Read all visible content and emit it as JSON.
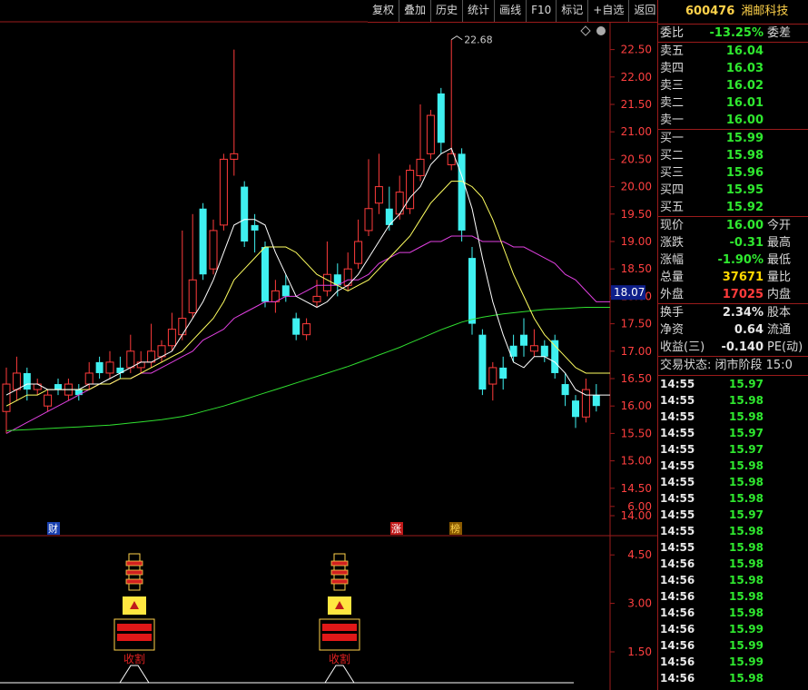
{
  "toolbar": [
    "复权",
    "叠加",
    "历史",
    "统计",
    "画线",
    "F10",
    "标记",
    "+自选",
    "返回"
  ],
  "stock": {
    "code": "600476",
    "name": "湘邮科技"
  },
  "quote": {
    "ratio": {
      "label": "委比",
      "value": "-13.25%",
      "suffix": "委差"
    },
    "asks": [
      {
        "label": "卖五",
        "price": "16.04"
      },
      {
        "label": "卖四",
        "price": "16.03"
      },
      {
        "label": "卖三",
        "price": "16.02"
      },
      {
        "label": "卖二",
        "price": "16.01"
      },
      {
        "label": "卖一",
        "price": "16.00"
      }
    ],
    "bids": [
      {
        "label": "买一",
        "price": "15.99"
      },
      {
        "label": "买二",
        "price": "15.98"
      },
      {
        "label": "买三",
        "price": "15.96"
      },
      {
        "label": "买四",
        "price": "15.95"
      },
      {
        "label": "买五",
        "price": "15.92"
      }
    ],
    "stats1": [
      {
        "label": "现价",
        "value": "16.00",
        "suffix": "今开",
        "color": "down"
      },
      {
        "label": "涨跌",
        "value": "-0.31",
        "suffix": "最高",
        "color": "down"
      },
      {
        "label": "涨幅",
        "value": "-1.90%",
        "suffix": "最低",
        "color": "down"
      },
      {
        "label": "总量",
        "value": "37671",
        "suffix": "量比",
        "color": "yel"
      },
      {
        "label": "外盘",
        "value": "17025",
        "suffix": "内盘",
        "color": "up"
      }
    ],
    "stats2": [
      {
        "label": "换手",
        "value": "2.34%",
        "suffix": "股本",
        "color": "wht"
      },
      {
        "label": "净资",
        "value": "0.64",
        "suffix": "流通",
        "color": "wht"
      },
      {
        "label": "收益(三)",
        "value": "-0.140",
        "suffix": "PE(动)",
        "color": "wht"
      }
    ],
    "status": "交易状态: 闭市阶段 15:0",
    "ticks": [
      [
        "14:55",
        "15.97"
      ],
      [
        "14:55",
        "15.98"
      ],
      [
        "14:55",
        "15.98"
      ],
      [
        "14:55",
        "15.97"
      ],
      [
        "14:55",
        "15.97"
      ],
      [
        "14:55",
        "15.98"
      ],
      [
        "14:55",
        "15.98"
      ],
      [
        "14:55",
        "15.98"
      ],
      [
        "14:55",
        "15.97"
      ],
      [
        "14:55",
        "15.98"
      ],
      [
        "14:55",
        "15.98"
      ],
      [
        "14:56",
        "15.98"
      ],
      [
        "14:56",
        "15.98"
      ],
      [
        "14:56",
        "15.98"
      ],
      [
        "14:56",
        "15.98"
      ],
      [
        "14:56",
        "15.99"
      ],
      [
        "14:56",
        "15.99"
      ],
      [
        "14:56",
        "15.99"
      ],
      [
        "14:56",
        "15.98"
      ]
    ]
  },
  "markers": {
    "cai": "财",
    "zhang": "涨",
    "bang": "榜",
    "harvest": "收割"
  },
  "current_price_tag": "18.07",
  "peak_label": "22.68",
  "colors": {
    "up": "#ff3b3b",
    "down": "#3ff0f0",
    "ma5": "#ffffff",
    "ma10": "#ffff60",
    "ma20": "#e040e0",
    "ma60": "#30e030",
    "grid": "#9b1b1b",
    "axis_text": "#ff4040"
  },
  "chart_data": [
    {
      "type": "candlestick",
      "ylim": [
        13.75,
        22.75
      ],
      "y_ticks": [
        "22.50",
        "22.00",
        "21.50",
        "21.00",
        "20.50",
        "20.00",
        "19.50",
        "19.00",
        "18.50",
        "18.00",
        "17.50",
        "17.00",
        "16.50",
        "16.00",
        "15.50",
        "15.00",
        "14.50",
        "14.00"
      ],
      "candles": [
        [
          15.9,
          16.4,
          16.7,
          15.5
        ],
        [
          16.3,
          16.6,
          16.9,
          16.1
        ],
        [
          16.6,
          16.3,
          16.7,
          16.1
        ],
        [
          16.3,
          16.4,
          16.5,
          16.2
        ],
        [
          16.0,
          16.2,
          16.3,
          15.9
        ],
        [
          16.4,
          16.3,
          16.5,
          16.2
        ],
        [
          16.2,
          16.4,
          16.5,
          16.1
        ],
        [
          16.3,
          16.2,
          16.4,
          16.1
        ],
        [
          16.4,
          16.6,
          16.8,
          16.3
        ],
        [
          16.8,
          16.6,
          16.9,
          16.5
        ],
        [
          16.6,
          16.8,
          17.0,
          16.5
        ],
        [
          16.7,
          16.6,
          16.9,
          16.5
        ],
        [
          16.7,
          17.0,
          17.3,
          16.6
        ],
        [
          16.7,
          16.8,
          17.0,
          16.6
        ],
        [
          16.8,
          17.0,
          17.5,
          16.7
        ],
        [
          16.9,
          17.1,
          17.2,
          16.8
        ],
        [
          17.1,
          17.4,
          17.7,
          17.0
        ],
        [
          17.3,
          17.6,
          19.2,
          17.2
        ],
        [
          17.7,
          18.3,
          19.5,
          17.6
        ],
        [
          19.6,
          18.4,
          19.7,
          18.3
        ],
        [
          18.5,
          19.2,
          19.4,
          18.4
        ],
        [
          19.3,
          20.5,
          20.6,
          19.2
        ],
        [
          20.5,
          20.6,
          22.5,
          20.2
        ],
        [
          20.0,
          19.0,
          20.1,
          18.9
        ],
        [
          19.3,
          19.2,
          19.5,
          18.8
        ],
        [
          18.9,
          17.9,
          19.0,
          17.8
        ],
        [
          17.9,
          18.1,
          18.3,
          17.7
        ],
        [
          18.2,
          18.0,
          18.4,
          17.9
        ],
        [
          17.6,
          17.3,
          17.7,
          17.2
        ],
        [
          17.3,
          17.5,
          17.6,
          17.2
        ],
        [
          17.9,
          18.0,
          18.3,
          17.8
        ],
        [
          18.1,
          18.4,
          19.0,
          18.0
        ],
        [
          18.4,
          18.2,
          18.6,
          18.0
        ],
        [
          18.2,
          18.5,
          18.8,
          18.1
        ],
        [
          18.6,
          19.0,
          19.4,
          18.5
        ],
        [
          19.2,
          19.6,
          20.5,
          19.1
        ],
        [
          19.7,
          20.0,
          20.6,
          19.5
        ],
        [
          19.6,
          19.3,
          20.0,
          19.2
        ],
        [
          19.5,
          19.9,
          20.2,
          19.4
        ],
        [
          19.6,
          20.3,
          20.4,
          19.5
        ],
        [
          20.2,
          20.5,
          21.5,
          20.1
        ],
        [
          20.6,
          21.3,
          21.4,
          20.5
        ],
        [
          21.7,
          20.8,
          21.8,
          20.6
        ],
        [
          20.4,
          20.6,
          22.68,
          20.3
        ],
        [
          20.6,
          19.2,
          20.7,
          19.0
        ],
        [
          18.7,
          17.5,
          18.9,
          17.3
        ],
        [
          17.3,
          16.3,
          17.4,
          16.2
        ],
        [
          16.4,
          16.7,
          16.8,
          16.1
        ],
        [
          16.7,
          16.5,
          16.9,
          16.3
        ],
        [
          17.1,
          16.9,
          17.3,
          16.8
        ],
        [
          17.3,
          17.1,
          17.6,
          16.9
        ],
        [
          17.0,
          17.1,
          17.4,
          16.9
        ],
        [
          17.1,
          16.9,
          17.2,
          16.8
        ],
        [
          17.2,
          16.6,
          17.3,
          16.5
        ],
        [
          16.4,
          16.2,
          16.6,
          16.0
        ],
        [
          16.1,
          15.8,
          16.2,
          15.6
        ],
        [
          15.8,
          16.3,
          16.5,
          15.7
        ],
        [
          16.2,
          16.0,
          16.4,
          15.9
        ]
      ],
      "ma_values": {
        "ma5": [
          16.2,
          16.3,
          16.4,
          16.4,
          16.3,
          16.3,
          16.3,
          16.3,
          16.4,
          16.4,
          16.5,
          16.6,
          16.7,
          16.8,
          16.8,
          16.9,
          17.0,
          17.3,
          17.6,
          17.9,
          18.3,
          18.8,
          19.3,
          19.4,
          19.4,
          19.3,
          18.8,
          18.4,
          18.0,
          17.9,
          17.8,
          17.9,
          18.1,
          18.2,
          18.4,
          18.7,
          19.0,
          19.3,
          19.5,
          19.8,
          20.0,
          20.4,
          20.6,
          20.7,
          20.2,
          19.6,
          18.7,
          17.9,
          17.3,
          16.8,
          16.7,
          16.9,
          16.9,
          16.8,
          16.6,
          16.3,
          16.2,
          16.2
        ],
        "ma10": [
          16.0,
          16.1,
          16.2,
          16.2,
          16.3,
          16.3,
          16.3,
          16.3,
          16.3,
          16.4,
          16.4,
          16.5,
          16.5,
          16.6,
          16.7,
          16.8,
          16.9,
          17.0,
          17.2,
          17.4,
          17.6,
          17.9,
          18.3,
          18.5,
          18.7,
          18.9,
          18.9,
          18.9,
          18.8,
          18.6,
          18.4,
          18.3,
          18.2,
          18.1,
          18.2,
          18.3,
          18.5,
          18.7,
          18.9,
          19.1,
          19.4,
          19.7,
          19.9,
          20.1,
          20.1,
          20.0,
          19.8,
          19.4,
          18.9,
          18.4,
          18.0,
          17.6,
          17.3,
          17.1,
          16.9,
          16.7,
          16.6,
          16.6
        ],
        "ma20": [
          15.5,
          15.6,
          15.7,
          15.8,
          15.9,
          16.0,
          16.1,
          16.2,
          16.3,
          16.4,
          16.4,
          16.5,
          16.5,
          16.6,
          16.6,
          16.7,
          16.8,
          16.9,
          17.0,
          17.2,
          17.3,
          17.4,
          17.6,
          17.7,
          17.8,
          17.9,
          17.9,
          18.0,
          18.0,
          18.1,
          18.2,
          18.2,
          18.2,
          18.3,
          18.3,
          18.4,
          18.6,
          18.7,
          18.8,
          18.8,
          18.9,
          19.0,
          19.0,
          19.1,
          19.1,
          19.1,
          19.0,
          19.0,
          19.0,
          18.9,
          18.9,
          18.8,
          18.7,
          18.6,
          18.4,
          18.3,
          18.1,
          17.9
        ],
        "ma60": [
          15.55,
          15.56,
          15.57,
          15.58,
          15.59,
          15.6,
          15.61,
          15.62,
          15.63,
          15.64,
          15.65,
          15.67,
          15.69,
          15.71,
          15.73,
          15.75,
          15.78,
          15.81,
          15.85,
          15.9,
          15.95,
          16.0,
          16.06,
          16.12,
          16.18,
          16.24,
          16.3,
          16.36,
          16.42,
          16.48,
          16.54,
          16.6,
          16.66,
          16.72,
          16.79,
          16.86,
          16.93,
          17.0,
          17.07,
          17.15,
          17.23,
          17.31,
          17.39,
          17.46,
          17.53,
          17.58,
          17.62,
          17.65,
          17.68,
          17.7,
          17.72,
          17.74,
          17.76,
          17.77,
          17.78,
          17.79,
          17.8,
          17.8
        ]
      }
    },
    {
      "type": "indicator",
      "ylim": [
        0,
        7.0
      ],
      "y_ticks": [
        "6.00",
        "4.50",
        "3.00",
        "1.50"
      ]
    }
  ]
}
